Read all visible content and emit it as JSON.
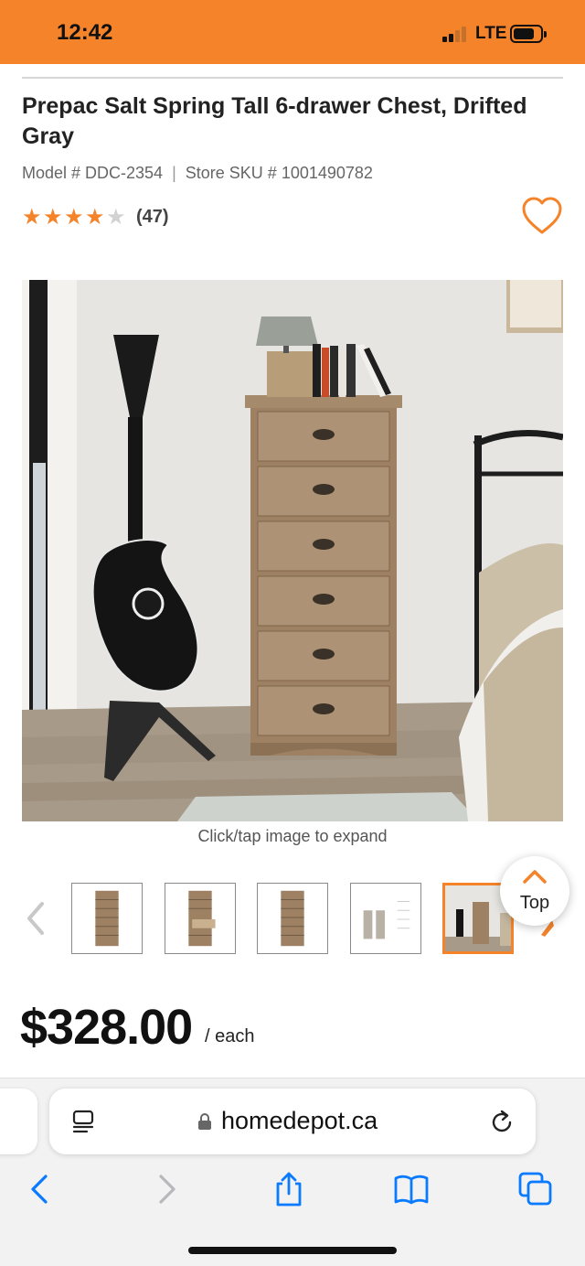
{
  "status_bar": {
    "time": "12:42",
    "network": "LTE",
    "color": "#f4832a"
  },
  "product": {
    "brand": "Prepac",
    "name": "Salt Spring Tall 6-drawer Chest, Drifted Gray",
    "model": "Model # DDC-2354",
    "sku": "Store SKU # 1001490782",
    "rating_stars": 4,
    "rating_max": 5,
    "review_count": "(47)",
    "image_hint": "Click/tap image to expand",
    "price": "$328.00",
    "price_unit": "/ each"
  },
  "thumbnails": {
    "count": 5,
    "selected_index": 4
  },
  "top_button": {
    "label": "Top"
  },
  "browser": {
    "url": "homedepot.ca"
  },
  "icons": [
    "heart-icon",
    "chevron-left-icon",
    "chevron-up-icon",
    "reader-icon",
    "lock-icon",
    "reload-icon",
    "back-icon",
    "forward-icon",
    "share-icon",
    "bookmarks-icon",
    "tabs-icon"
  ],
  "colors": {
    "accent": "#f4832a",
    "ios_blue": "#0a7aff"
  }
}
